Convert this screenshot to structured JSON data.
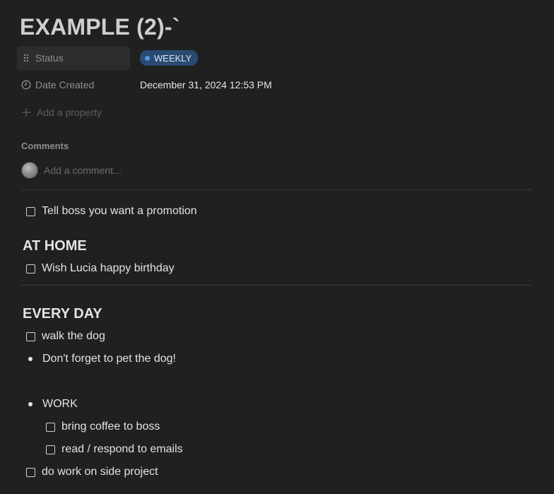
{
  "page": {
    "title": "EXAMPLE (2)-`"
  },
  "properties": {
    "status": {
      "label": "Status",
      "value": "WEEKLY",
      "color": "#2a4a72",
      "dot_color": "#4b9ae8"
    },
    "date_created": {
      "label": "Date Created",
      "value": "December 31, 2024 12:53 PM"
    },
    "add_property": "Add a property"
  },
  "comments": {
    "heading": "Comments",
    "placeholder": "Add a comment..."
  },
  "blocks": {
    "todo_promotion": "Tell boss you want a promotion",
    "heading_home": "AT HOME",
    "todo_lucia": "Wish Lucia happy birthday",
    "heading_everyday": "EVERY DAY",
    "todo_dog": "walk the dog",
    "bullet_pet": "Don't forget to pet the dog!",
    "bullet_work": "WORK",
    "todo_coffee": "bring coffee to boss",
    "todo_emails": "read / respond to emails",
    "todo_side": "do work on side project"
  },
  "icons": {
    "status": "drag-handle-icon",
    "date": "clock-icon",
    "add": "plus-icon"
  },
  "theme": {
    "background": "#202020",
    "text": "#e3e3e3",
    "muted": "#8e8e8e"
  }
}
